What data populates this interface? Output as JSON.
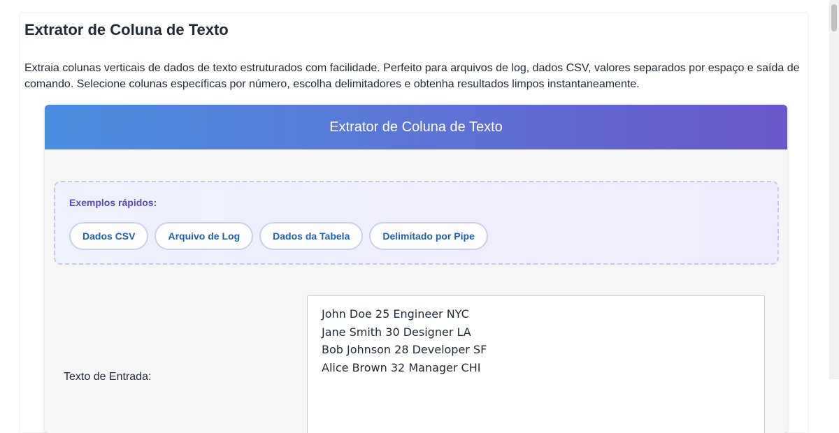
{
  "page": {
    "title": "Extrator de Coluna de Texto",
    "description": "Extraia colunas verticais de dados de texto estruturados com facilidade. Perfeito para arquivos de log, dados CSV, valores separados por espaço e saída de comando. Selecione colunas específicas por número, escolha delimitadores e obtenha resultados limpos instantaneamente."
  },
  "tool": {
    "header_title": "Extrator de Coluna de Texto",
    "examples": {
      "label": "Exemplos rápidos:",
      "buttons": [
        "Dados CSV",
        "Arquivo de Log",
        "Dados da Tabela",
        "Delimitado por Pipe"
      ]
    },
    "input": {
      "label": "Texto de Entrada:",
      "value": "John Doe 25 Engineer NYC\nJane Smith 30 Designer LA\nBob Johnson 28 Developer SF\nAlice Brown 32 Manager CHI"
    }
  },
  "colors": {
    "header_gradient_start": "#4a8ee0",
    "header_gradient_end": "#6a58cc",
    "examples_label": "#5a46c0",
    "chip_text": "#1f5fb8"
  }
}
